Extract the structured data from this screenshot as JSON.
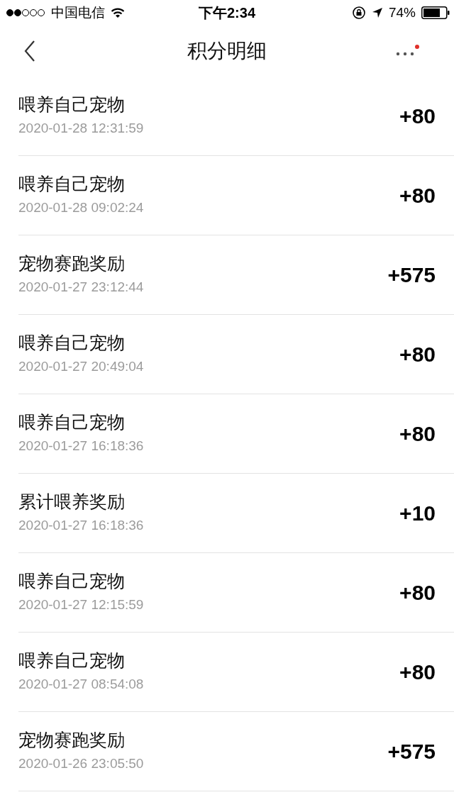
{
  "status_bar": {
    "carrier": "中国电信",
    "time": "下午2:34",
    "battery": "74%"
  },
  "header": {
    "title": "积分明细"
  },
  "records": [
    {
      "title": "喂养自己宠物",
      "time": "2020-01-28 12:31:59",
      "points": "+80"
    },
    {
      "title": "喂养自己宠物",
      "time": "2020-01-28 09:02:24",
      "points": "+80"
    },
    {
      "title": "宠物赛跑奖励",
      "time": "2020-01-27 23:12:44",
      "points": "+575"
    },
    {
      "title": "喂养自己宠物",
      "time": "2020-01-27 20:49:04",
      "points": "+80"
    },
    {
      "title": "喂养自己宠物",
      "time": "2020-01-27 16:18:36",
      "points": "+80"
    },
    {
      "title": "累计喂养奖励",
      "time": "2020-01-27 16:18:36",
      "points": "+10"
    },
    {
      "title": "喂养自己宠物",
      "time": "2020-01-27 12:15:59",
      "points": "+80"
    },
    {
      "title": "喂养自己宠物",
      "time": "2020-01-27 08:54:08",
      "points": "+80"
    },
    {
      "title": "宠物赛跑奖励",
      "time": "2020-01-26 23:05:50",
      "points": "+575"
    }
  ]
}
